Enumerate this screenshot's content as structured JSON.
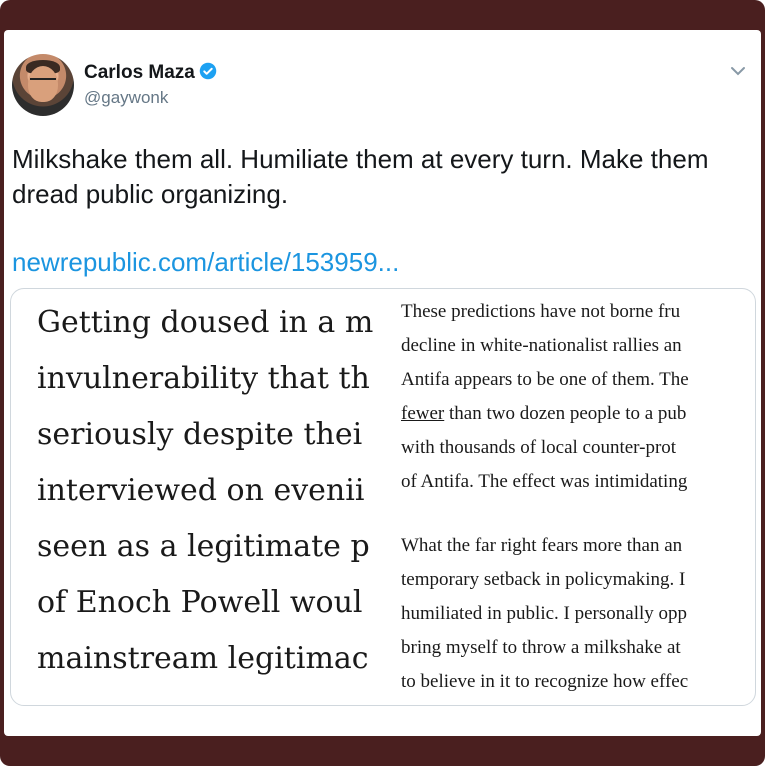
{
  "tweet": {
    "author_name": "Carlos Maza",
    "handle": "@gaywonk",
    "text": "Milkshake them all. Humiliate them at every turn. Make them dread public organizing.",
    "link": "newrepublic.com/article/153959..."
  },
  "preview": {
    "left_lines": [
      "Getting doused in a m",
      "invulnerability that th",
      "seriously despite thei",
      "interviewed on evenii",
      "seen as a legitimate p",
      "of Enoch Powell woul",
      "mainstream legitimac"
    ],
    "right_para1": [
      "These predictions have not borne fru",
      "decline in white-nationalist rallies an",
      "Antifa appears to be one of them. The",
      "fewer",
      " than two dozen people to a pub",
      "with thousands of local counter-prot",
      "of Antifa. The effect was intimidating"
    ],
    "right_para2": [
      "What the far right fears more than an",
      "temporary setback in policymaking. I",
      "humiliated in public. I personally opp",
      "bring myself to throw a milkshake at",
      "to believe in it to recognize how effec"
    ]
  },
  "colors": {
    "frame": "#4a1f1f",
    "link": "#1b95e0",
    "verified": "#1da1f2"
  },
  "icons": {
    "verified": "verified-badge-icon",
    "chevron": "chevron-down-icon"
  }
}
